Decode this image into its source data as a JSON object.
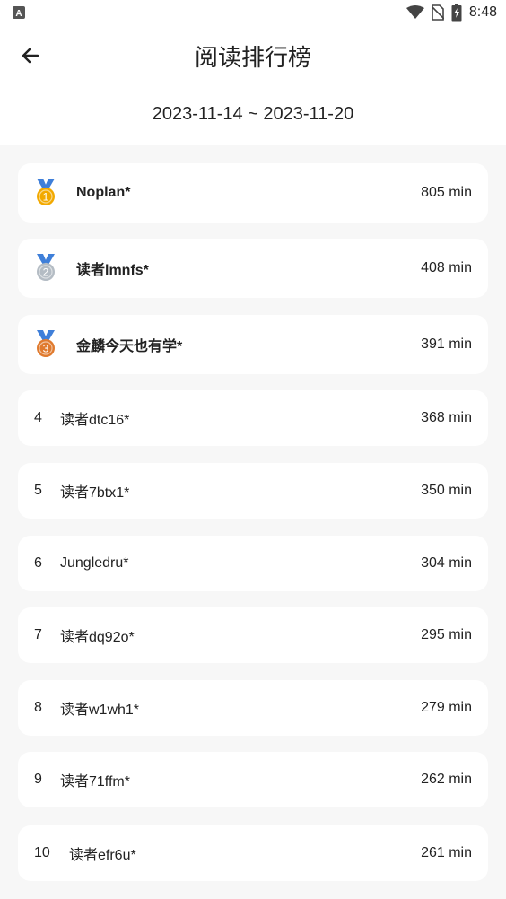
{
  "status_bar": {
    "time": "8:48",
    "icons": [
      "app-a-icon",
      "wifi-icon",
      "no-sim-icon",
      "battery-icon"
    ]
  },
  "header": {
    "title": "阅读排行榜",
    "date_range": "2023-11-14 ~ 2023-11-20"
  },
  "colors": {
    "gold": "#f2a900",
    "silver": "#b4bcc4",
    "bronze": "#e07a2e",
    "ribbon": "#3f7fd9"
  },
  "ranking": [
    {
      "rank": "1",
      "medal": "gold",
      "name": "Noplan*",
      "minutes": "805 min"
    },
    {
      "rank": "2",
      "medal": "silver",
      "name": "读者lmnfs*",
      "minutes": "408 min"
    },
    {
      "rank": "3",
      "medal": "bronze",
      "name": "金麟今天也有学*",
      "minutes": "391 min"
    },
    {
      "rank": "4",
      "name": "读者dtc16*",
      "minutes": "368 min"
    },
    {
      "rank": "5",
      "name": "读者7btx1*",
      "minutes": "350 min"
    },
    {
      "rank": "6",
      "name": "Jungledru*",
      "minutes": "304 min"
    },
    {
      "rank": "7",
      "name": "读者dq92o*",
      "minutes": "295 min"
    },
    {
      "rank": "8",
      "name": "读者w1wh1*",
      "minutes": "279 min"
    },
    {
      "rank": "9",
      "name": "读者71ffm*",
      "minutes": "262 min"
    },
    {
      "rank": "10",
      "name": "读者efr6u*",
      "minutes": "261 min"
    }
  ]
}
